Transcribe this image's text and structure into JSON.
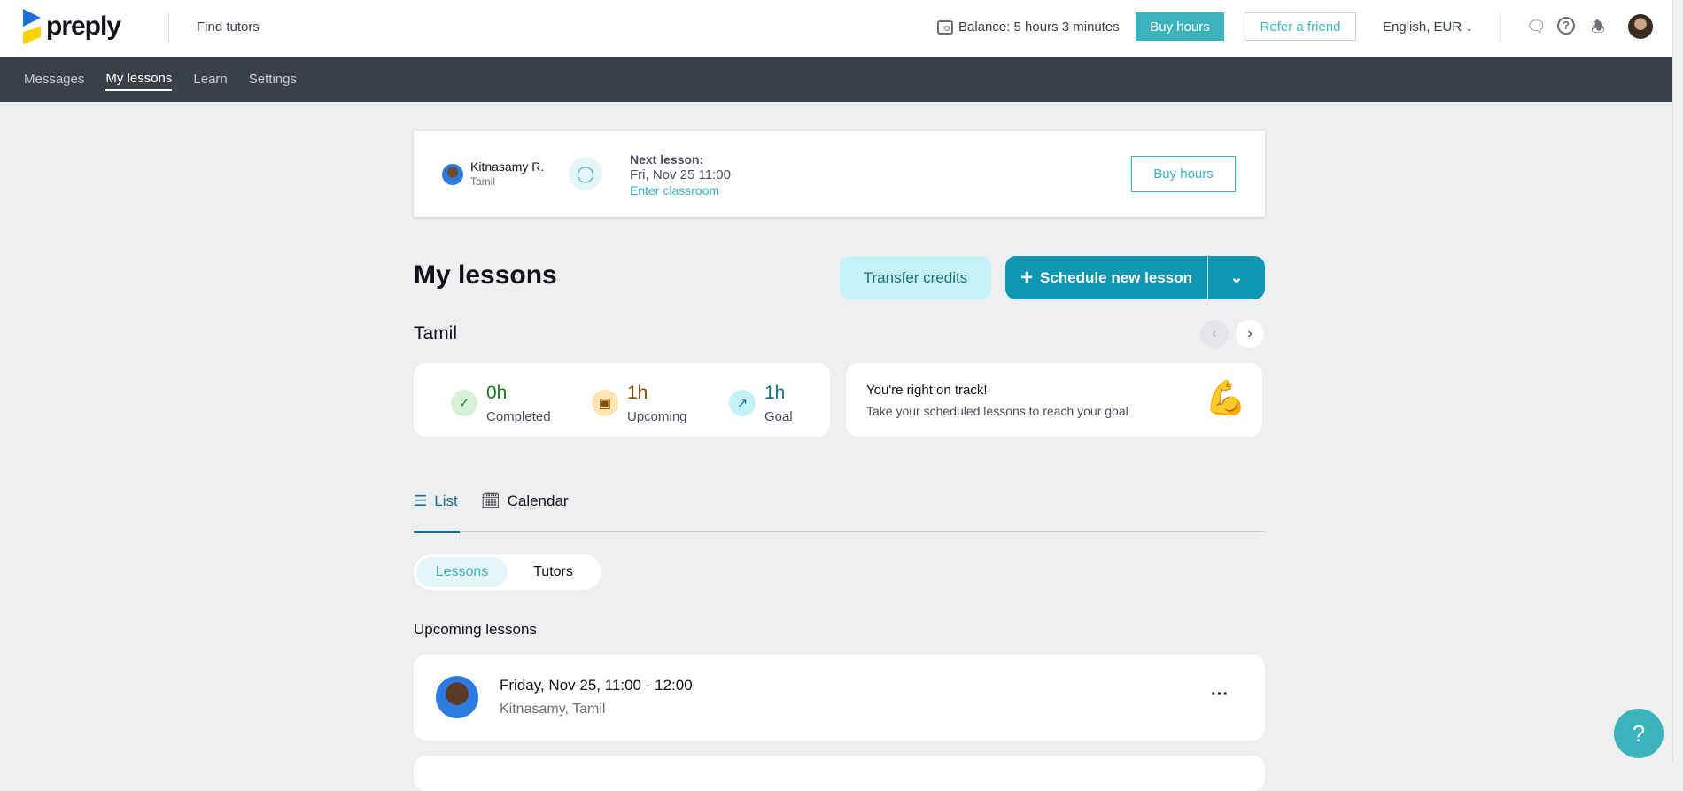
{
  "header": {
    "brand": "preply",
    "find_tutors": "Find tutors",
    "balance": "Balance: 5 hours 3 minutes",
    "buy_hours": "Buy hours",
    "refer": "Refer a friend",
    "language": "English, EUR"
  },
  "nav": {
    "items": [
      "Messages",
      "My lessons",
      "Learn",
      "Settings"
    ],
    "active": "My lessons"
  },
  "next": {
    "tutor_name": "Kitnasamy R.",
    "subject": "Tamil",
    "label": "Next lesson:",
    "datetime": "Fri, Nov 25 11:00",
    "enter": "Enter classroom",
    "buy_hours": "Buy hours"
  },
  "main": {
    "title": "My lessons",
    "transfer": "Transfer credits",
    "schedule": "Schedule new lesson",
    "language": "Tamil"
  },
  "stats": [
    {
      "value": "0h",
      "label": "Completed",
      "color": "#1c7a1c"
    },
    {
      "value": "1h",
      "label": "Upcoming",
      "color": "#8a4a00"
    },
    {
      "value": "1h",
      "label": "Goal",
      "color": "#16708a"
    }
  ],
  "track": {
    "title": "You're right on track!",
    "text": "Take your scheduled lessons to reach your goal"
  },
  "tabs": {
    "list": "List",
    "calendar": "Calendar"
  },
  "segment": {
    "lessons": "Lessons",
    "tutors": "Tutors"
  },
  "upcoming": {
    "heading": "Upcoming lessons",
    "lessons": [
      {
        "time": "Friday, Nov 25, 11:00 - 12:00",
        "who": "Kitnasamy, Tamil"
      }
    ]
  },
  "help": "?"
}
